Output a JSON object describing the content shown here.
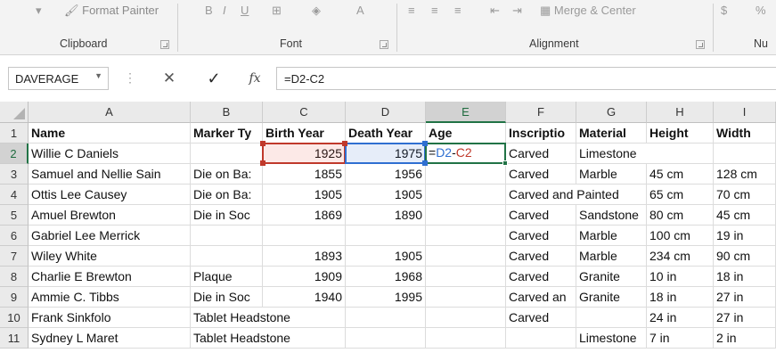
{
  "ribbon": {
    "format_painter": "Format Painter",
    "merge_center": "Merge & Center",
    "currency": "$",
    "percent": "%",
    "groups": {
      "clipboard": "Clipboard",
      "font": "Font",
      "alignment": "Alignment",
      "number": "Nu"
    }
  },
  "formula_bar": {
    "name_box": "DAVERAGE",
    "cancel": "✕",
    "enter": "✓",
    "fx": "fx",
    "formula": "=D2-C2"
  },
  "columns": [
    "A",
    "B",
    "C",
    "D",
    "E",
    "F",
    "G",
    "H",
    "I"
  ],
  "row_numbers": [
    "1",
    "2",
    "3",
    "4",
    "5",
    "6",
    "7",
    "8",
    "9",
    "10",
    "11"
  ],
  "headers": [
    "Name",
    "Marker Ty",
    "Birth Year",
    "Death Year",
    "Age",
    "Inscriptio",
    "Material",
    "Height",
    "Width"
  ],
  "rows": [
    [
      "Willie C Daniels",
      "",
      "1925",
      "1975",
      "",
      "Carved",
      "Limestone",
      "",
      ""
    ],
    [
      "Samuel and Nellie Sain",
      "Die on Ba:",
      "1855",
      "1956",
      "",
      "Carved",
      "Marble",
      "45 cm",
      "128 cm"
    ],
    [
      "Ottis Lee Causey",
      "Die on Ba:",
      "1905",
      "1905",
      "",
      "Carved and Painted",
      "",
      "65 cm",
      "70 cm"
    ],
    [
      "Amuel Brewton",
      "Die in Soc",
      "1869",
      "1890",
      "",
      "Carved",
      "Sandstone",
      "80 cm",
      "45 cm"
    ],
    [
      "Gabriel Lee Merrick",
      "",
      "",
      "",
      "",
      "Carved",
      "Marble",
      "100 cm",
      "19 in"
    ],
    [
      "Wiley White",
      "",
      "1893",
      "1905",
      "",
      "Carved",
      "Marble",
      "234 cm",
      "90 cm"
    ],
    [
      "Charlie E Brewton",
      "Plaque",
      "1909",
      "1968",
      "",
      "Carved",
      "Granite",
      "10 in",
      "18 in"
    ],
    [
      "Ammie C. Tibbs",
      "Die in Soc",
      "1940",
      "1995",
      "",
      "Carved an",
      "Granite",
      "18 in",
      "27 in"
    ],
    [
      "Frank Sinkfolo",
      "Tablet Headstone",
      "",
      "",
      "",
      "Carved",
      "",
      "24 in",
      "27 in"
    ],
    [
      "Sydney L Maret",
      "Tablet Headstone",
      "",
      "",
      "",
      "",
      "Limestone",
      "7 in",
      "2 in"
    ]
  ],
  "active_cell": {
    "prefix": "=",
    "ref1": "D2",
    "op": "-",
    "ref2": "C2"
  },
  "colors": {
    "accent": "#217346",
    "ref_red": "#c0392b",
    "ref_blue": "#2f6fd1"
  }
}
